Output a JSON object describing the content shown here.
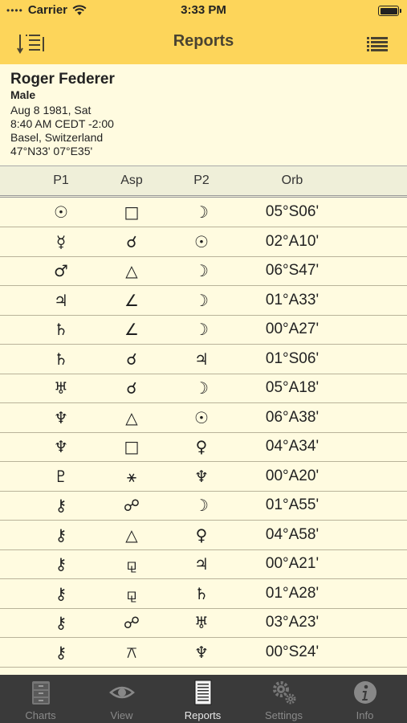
{
  "status": {
    "dots": "••••",
    "carrier": "Carrier",
    "time": "3:33 PM"
  },
  "nav": {
    "title": "Reports",
    "left_icon": "sort-icon",
    "right_icon": "list-icon"
  },
  "person": {
    "name": "Roger Federer",
    "gender": "Male",
    "date": "Aug 8 1981, Sat",
    "time": "8:40 AM CEDT -2:00",
    "place": "Basel, Switzerland",
    "coords": "47°N33' 07°E35'"
  },
  "table": {
    "headers": [
      "P1",
      "Asp",
      "P2",
      "Orb"
    ],
    "rows": [
      {
        "p1": "☉",
        "asp": "□",
        "p2": "☽",
        "orb": "05°S06'"
      },
      {
        "p1": "☿",
        "asp": "☌",
        "p2": "☉",
        "orb": "02°A10'"
      },
      {
        "p1": "♂",
        "asp": "△",
        "p2": "☽",
        "orb": "06°S47'"
      },
      {
        "p1": "♃",
        "asp": "∠",
        "p2": "☽",
        "orb": "01°A33'"
      },
      {
        "p1": "♄",
        "asp": "∠",
        "p2": "☽",
        "orb": "00°A27'"
      },
      {
        "p1": "♄",
        "asp": "☌",
        "p2": "♃",
        "orb": "01°S06'"
      },
      {
        "p1": "♅",
        "asp": "☌",
        "p2": "☽",
        "orb": "05°A18'"
      },
      {
        "p1": "♆",
        "asp": "△",
        "p2": "☉",
        "orb": "06°A38'"
      },
      {
        "p1": "♆",
        "asp": "□",
        "p2": "♀",
        "orb": "04°A34'"
      },
      {
        "p1": "♇",
        "asp": "⚹",
        "p2": "♆",
        "orb": "00°A20'"
      },
      {
        "p1": "⚷",
        "asp": "☍",
        "p2": "☽",
        "orb": "01°A55'"
      },
      {
        "p1": "⚷",
        "asp": "△",
        "p2": "♀",
        "orb": "04°A58'"
      },
      {
        "p1": "⚷",
        "asp": "⚼",
        "p2": "♃",
        "orb": "00°A21'"
      },
      {
        "p1": "⚷",
        "asp": "⚼",
        "p2": "♄",
        "orb": "01°A28'"
      },
      {
        "p1": "⚷",
        "asp": "☍",
        "p2": "♅",
        "orb": "03°A23'"
      },
      {
        "p1": "⚷",
        "asp": "⚻",
        "p2": "♆",
        "orb": "00°S24'"
      }
    ]
  },
  "tabs": [
    {
      "label": "Charts",
      "icon": "file-cabinet-icon",
      "active": false
    },
    {
      "label": "View",
      "icon": "eye-icon",
      "active": false
    },
    {
      "label": "Reports",
      "icon": "document-icon",
      "active": true
    },
    {
      "label": "Settings",
      "icon": "gears-icon",
      "active": false
    },
    {
      "label": "Info",
      "icon": "info-icon",
      "active": false
    }
  ],
  "colors": {
    "nav_bg": "#fdd55a",
    "page_bg": "#fffbe0",
    "tab_bg": "#3a3a3a"
  }
}
